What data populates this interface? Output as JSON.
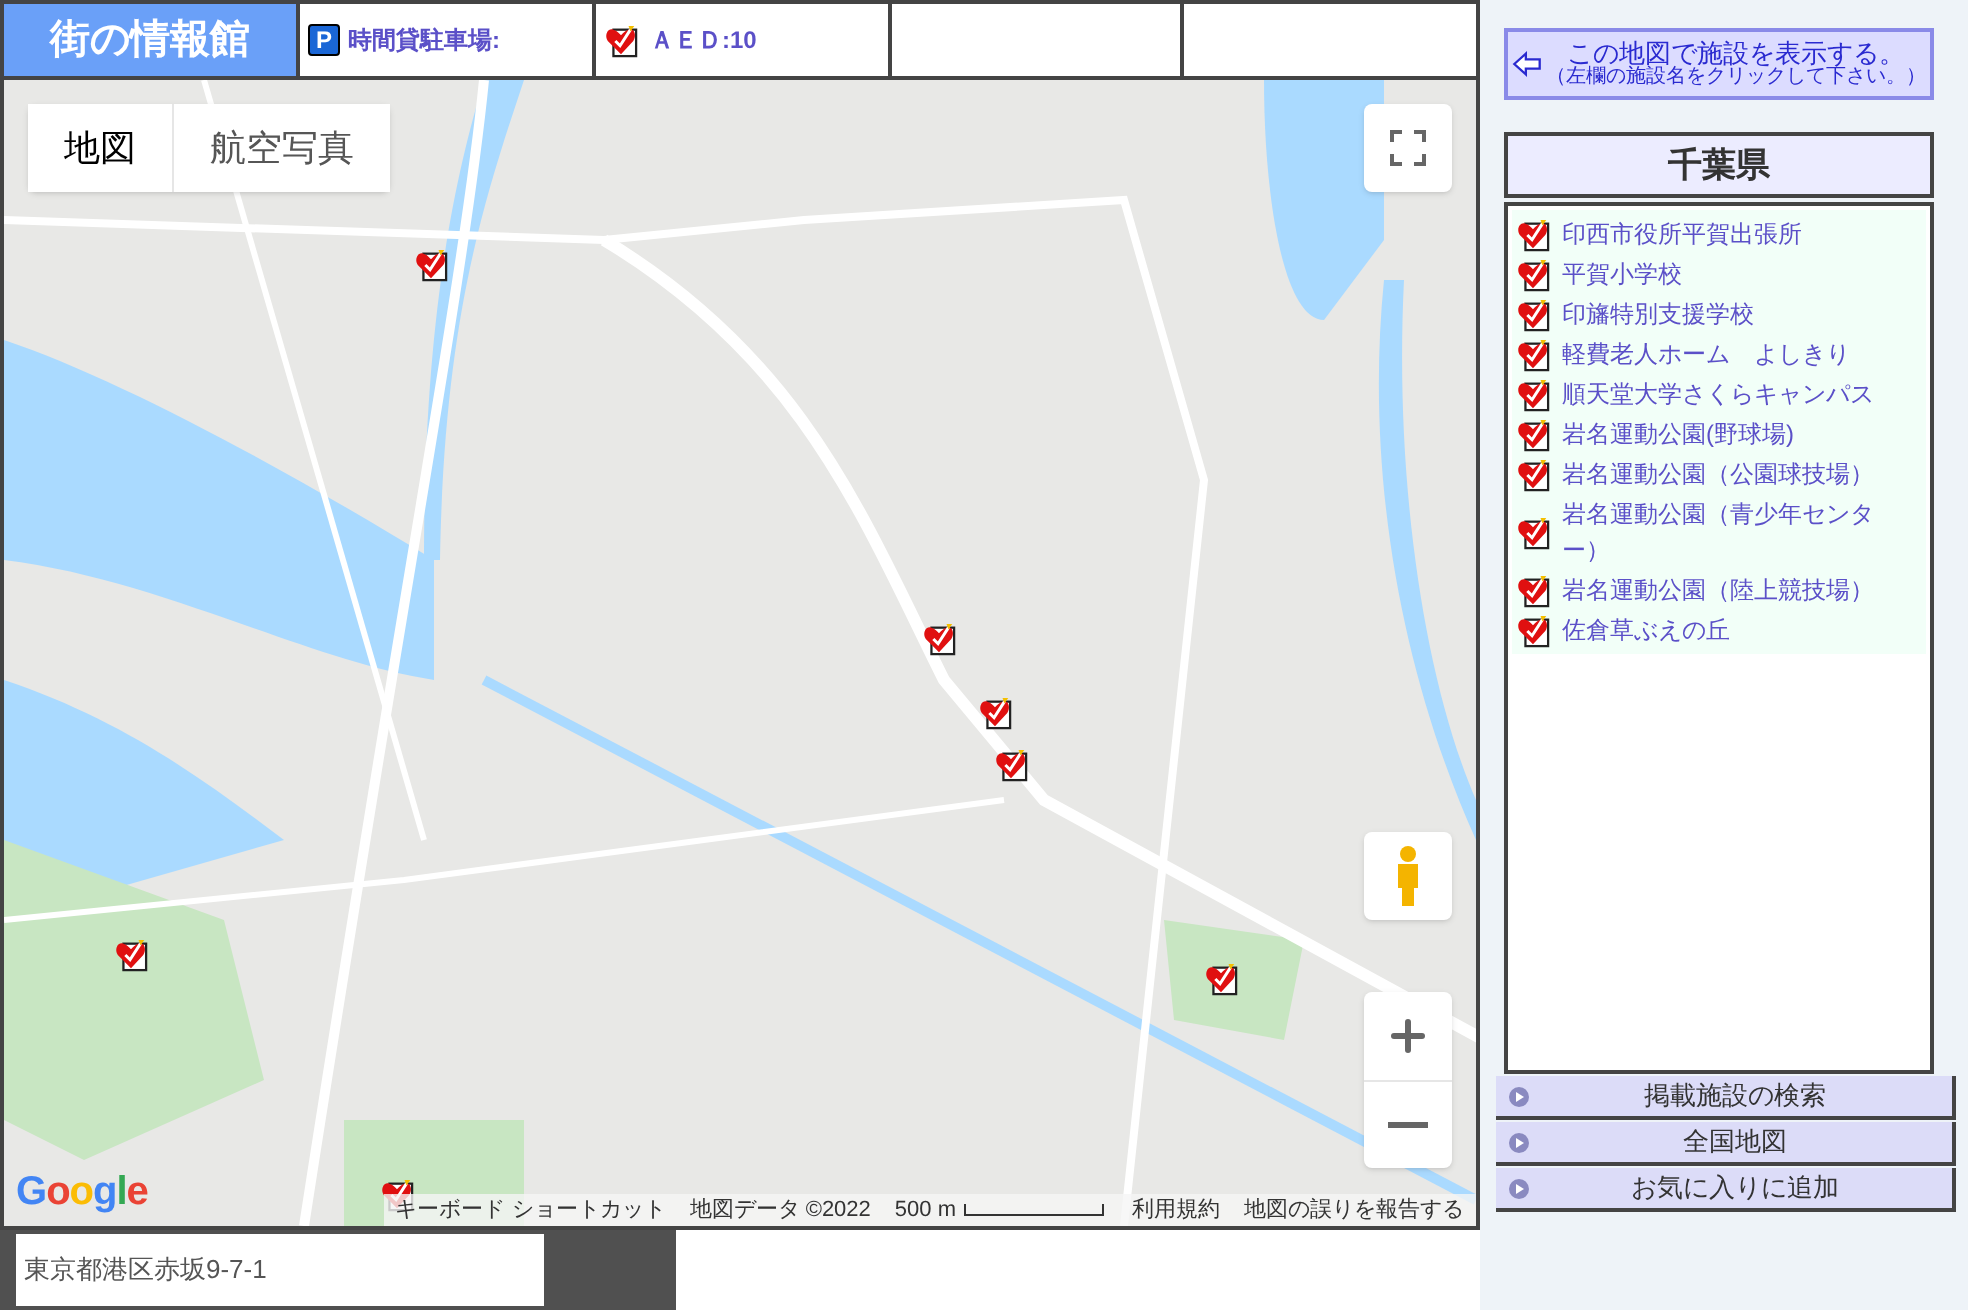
{
  "header": {
    "logo": "街の情報館",
    "parking_icon": "P",
    "parking_label": "時間貸駐車場:",
    "aed_label": "ＡＥＤ:10"
  },
  "map": {
    "map_types": [
      {
        "label": "地図",
        "selected": true
      },
      {
        "label": "航空写真",
        "selected": false
      }
    ],
    "attribution_logo": "Google",
    "footer": [
      "キーボード ショートカット",
      "地図データ ©2022"
    ],
    "scale": "500 m",
    "footer_links": [
      "利用規約",
      "地図の誤りを報告する"
    ]
  },
  "address_field": {
    "value": "東京都港区赤坂9-7-1"
  },
  "show_on_map_button": {
    "title": "この地図で施設を表示する。",
    "hint": "（左欄の施設名をクリックして下さい。）"
  },
  "prefecture": "千葉県",
  "facilities": [
    "印西市役所平賀出張所",
    "平賀小学校",
    "印旛特別支援学校",
    "軽費老人ホーム　よしきり",
    "順天堂大学さくらキャンパス",
    "岩名運動公園(野球場)",
    "岩名運動公園（公園球技場）",
    "岩名運動公園（青少年センター）",
    "岩名運動公園（陸上競技場）",
    "佐倉草ぶえの丘"
  ],
  "menu": [
    "掲載施設の検索",
    "全国地図",
    "お気に入りに追加"
  ]
}
